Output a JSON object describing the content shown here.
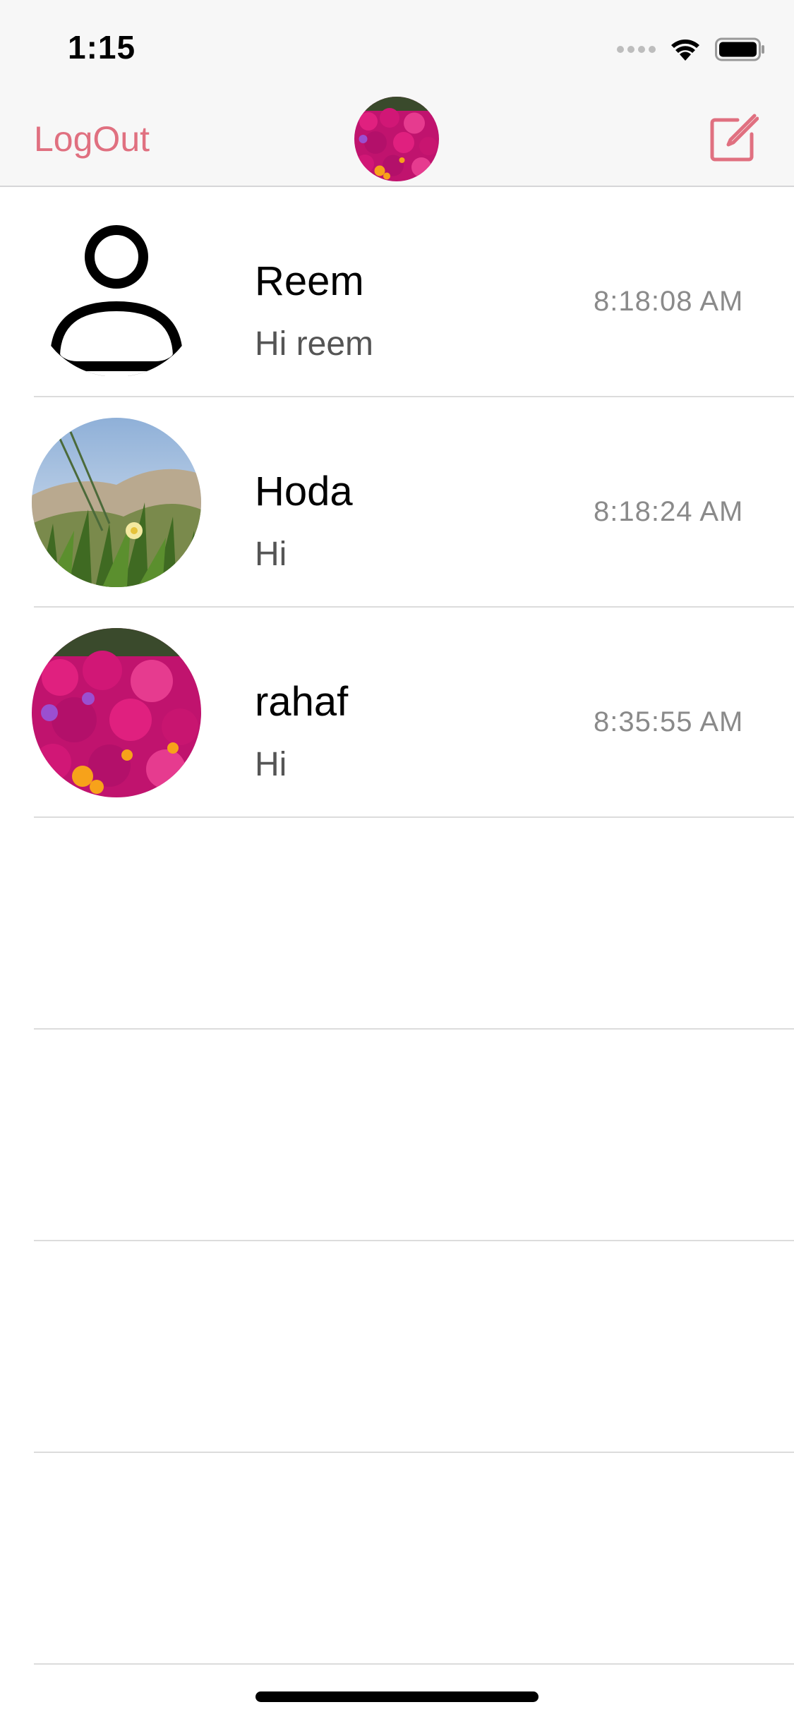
{
  "status_bar": {
    "time": "1:15"
  },
  "nav": {
    "logout_label": "LogOut",
    "accent_color": "#e07080"
  },
  "icons": {
    "signal": "signal-dots-icon",
    "wifi": "wifi-icon",
    "battery": "battery-icon",
    "compose": "compose-icon",
    "default_avatar": "person-placeholder-icon"
  },
  "chats": [
    {
      "name": "Reem",
      "message": "Hi reem",
      "time": "8:18:08 AM",
      "avatar": "person-placeholder"
    },
    {
      "name": "Hoda",
      "message": "Hi",
      "time": "8:18:24 AM",
      "avatar": "grass-flower-photo"
    },
    {
      "name": "rahaf",
      "message": "Hi",
      "time": "8:35:55 AM",
      "avatar": "magenta-flowers-photo"
    }
  ]
}
